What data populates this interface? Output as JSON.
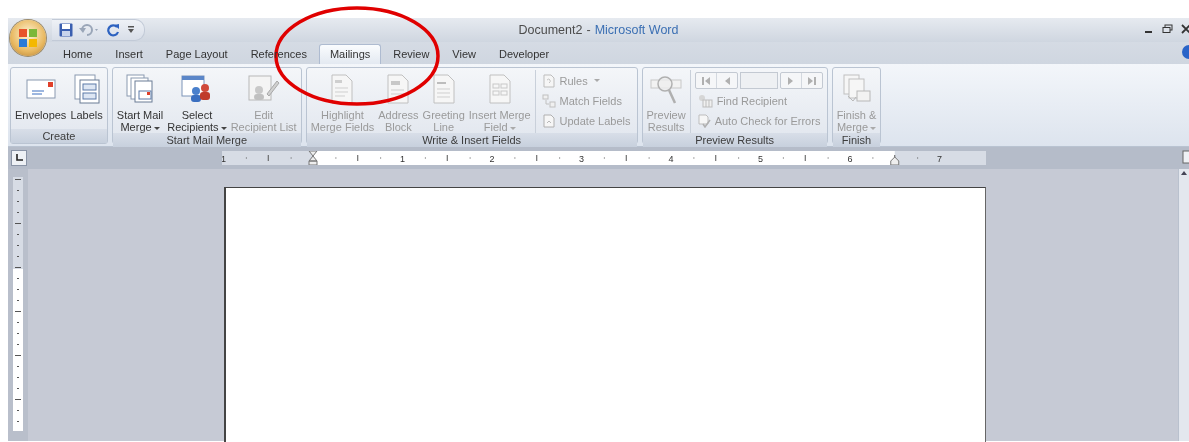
{
  "window": {
    "document": "Document2",
    "separator": "-",
    "app": "Microsoft Word"
  },
  "tabs": [
    {
      "label": "Home",
      "selected": false
    },
    {
      "label": "Insert",
      "selected": false
    },
    {
      "label": "Page Layout",
      "selected": false
    },
    {
      "label": "References",
      "selected": false
    },
    {
      "label": "Mailings",
      "selected": true
    },
    {
      "label": "Review",
      "selected": false
    },
    {
      "label": "View",
      "selected": false
    },
    {
      "label": "Developer",
      "selected": false
    }
  ],
  "ribbon_groups": [
    {
      "title": "Create",
      "columns": [
        {
          "kind": "large",
          "lines": [
            "Envelopes"
          ],
          "disabled": false,
          "dropdown": false
        },
        {
          "kind": "large",
          "lines": [
            "Labels"
          ],
          "disabled": false,
          "dropdown": false
        }
      ]
    },
    {
      "title": "Start Mail Merge",
      "columns": [
        {
          "kind": "large",
          "lines": [
            "Start Mail",
            "Merge"
          ],
          "disabled": false,
          "dropdown": true
        },
        {
          "kind": "large",
          "lines": [
            "Select",
            "Recipients"
          ],
          "disabled": false,
          "dropdown": true
        },
        {
          "kind": "large",
          "lines": [
            "Edit",
            "Recipient List"
          ],
          "disabled": true,
          "dropdown": false
        }
      ]
    },
    {
      "title": "Write & Insert Fields",
      "columns": [
        {
          "kind": "large",
          "lines": [
            "Highlight",
            "Merge Fields"
          ],
          "disabled": true,
          "dropdown": false
        },
        {
          "kind": "large",
          "lines": [
            "Address",
            "Block"
          ],
          "disabled": true,
          "dropdown": false
        },
        {
          "kind": "large",
          "lines": [
            "Greeting",
            "Line"
          ],
          "disabled": true,
          "dropdown": false
        },
        {
          "kind": "large",
          "lines": [
            "Insert Merge",
            "Field"
          ],
          "disabled": true,
          "dropdown": true
        },
        {
          "kind": "stack",
          "items": [
            {
              "kind": "small",
              "label": "Rules",
              "disabled": true,
              "dropdown": true
            },
            {
              "kind": "small",
              "label": "Match Fields",
              "disabled": true,
              "dropdown": false
            },
            {
              "kind": "small",
              "label": "Update Labels",
              "disabled": true,
              "dropdown": false
            }
          ]
        }
      ]
    },
    {
      "title": "Preview Results",
      "columns": [
        {
          "kind": "large",
          "lines": [
            "Preview",
            "Results"
          ],
          "disabled": true,
          "dropdown": false
        },
        {
          "kind": "stack",
          "items": [
            {
              "kind": "nav",
              "disabled": true
            },
            {
              "kind": "small",
              "label": "Find Recipient",
              "disabled": true,
              "dropdown": false
            },
            {
              "kind": "small",
              "label": "Auto Check for Errors",
              "disabled": true,
              "dropdown": false
            }
          ]
        }
      ]
    },
    {
      "title": "Finish",
      "columns": [
        {
          "kind": "large",
          "lines": [
            "Finish &",
            "Merge"
          ],
          "disabled": true,
          "dropdown": true
        }
      ]
    }
  ],
  "ruler": {
    "numbers": [
      "1",
      "1",
      "2",
      "3",
      "4",
      "5",
      "6",
      "7"
    ]
  }
}
